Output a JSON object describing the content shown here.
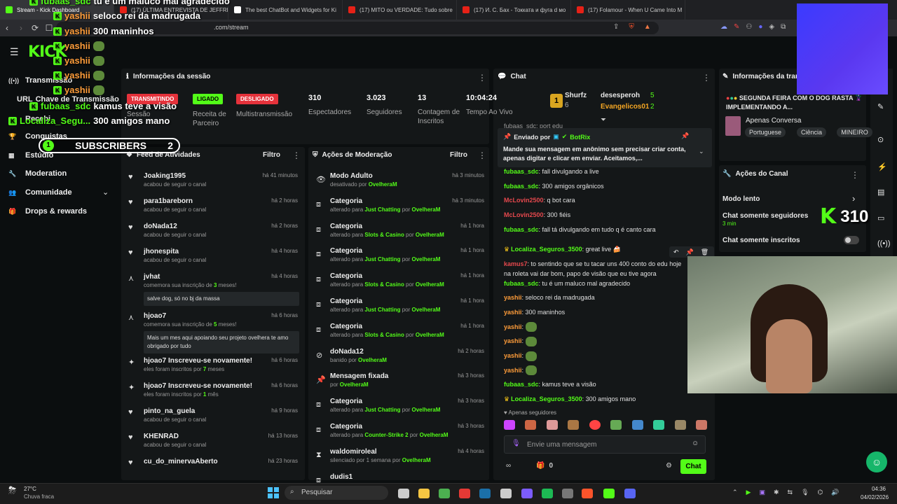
{
  "browser": {
    "tabs": [
      {
        "label": "Stream - Kick Dashboard",
        "color": "#53fc18",
        "active": true
      },
      {
        "label": "(17) ÚLTIMA ENTREVISTA DE JEFFREY",
        "color": "#e62117"
      },
      {
        "label": "The best ChatBot and Widgets for Ki",
        "color": "#ffffff"
      },
      {
        "label": "(17) MITO ou VERDADE: Tudo sobre",
        "color": "#e62117"
      },
      {
        "label": "(17) И. С. Бах - Токката и фуга d мо",
        "color": "#e62117"
      },
      {
        "label": "(17) Folamour - When U Came Into M",
        "color": "#e62117"
      }
    ],
    "url": "dashboard.kick.com/stream",
    "url_visible": ".com/stream"
  },
  "sidebar": {
    "items": [
      {
        "label": "Transmissão",
        "icon": "broadcast-icon"
      },
      {
        "label": "Chave de Transmissão",
        "icon": "key-icon"
      },
      {
        "label": "Conquistas",
        "icon": "trophy-icon"
      },
      {
        "label": "Estúdio",
        "icon": "studio-icon"
      },
      {
        "label": "Moderation",
        "icon": "wrench-icon"
      },
      {
        "label": "Comunidade",
        "icon": "users-icon"
      },
      {
        "label": "Drops & rewards",
        "icon": "gift-icon"
      }
    ],
    "extra": [
      "URL",
      "Recebi"
    ]
  },
  "session": {
    "title": "Informações da sessão",
    "badges": [
      {
        "text": "TRANSMITINDO",
        "color": "#e5323b",
        "label": "Sessão"
      },
      {
        "text": "LIGADO",
        "color": "#53fc18",
        "label": "Receita de Parceiro"
      },
      {
        "text": "DESLIGADO",
        "color": "#e5323b",
        "label": "Multistransmissão"
      }
    ],
    "stats": [
      {
        "value": "310",
        "label": "Espectadores"
      },
      {
        "value": "3.023",
        "label": "Seguidores"
      },
      {
        "value": "13",
        "label": "Contagem de Inscritos"
      },
      {
        "value": "10:04:24",
        "label": "Tempo Ao Vivo"
      }
    ]
  },
  "feed": {
    "title": "Feed de Atividades",
    "filter": "Filtro",
    "items": [
      {
        "name": "Joaking1995",
        "sub": "acabou de seguir o canal",
        "time": "há 41 minutos",
        "icon": "heart-icon"
      },
      {
        "name": "para1bareborn",
        "sub": "acabou de seguir o canal",
        "time": "há 2 horas",
        "icon": "heart-icon"
      },
      {
        "name": "doNada12",
        "sub": "acabou de seguir o canal",
        "time": "há 2 horas",
        "icon": "heart-icon"
      },
      {
        "name": "jhonespita",
        "sub": "acabou de seguir o canal",
        "time": "há 4 horas",
        "icon": "heart-icon"
      },
      {
        "name": "jvhat",
        "sub_pre": "comemora sua inscrição de ",
        "sub_num": "3",
        "sub_post": " meses!",
        "msg": "salve dog, só no bj da massa",
        "time": "há 4 horas",
        "icon": "sparkle-icon"
      },
      {
        "name": "hjoao7",
        "sub_pre": "comemora sua inscrição de ",
        "sub_num": "5",
        "sub_post": " meses!",
        "msg": "Mais um mes aqui apoiando seu projeto ovelhera te amo obrigado por tudo",
        "time": "há 6 horas",
        "icon": "sparkle-icon"
      },
      {
        "name": "hjoao7 Inscreveu-se novamente!",
        "sub_pre": "eles foram inscritos por ",
        "sub_num": "7",
        "sub_post": " meses",
        "time": "há 6 horas",
        "icon": "star-icon"
      },
      {
        "name": "hjoao7 Inscreveu-se novamente!",
        "sub_pre": "eles foram inscritos por ",
        "sub_num": "1",
        "sub_post": " mês",
        "time": "há 6 horas",
        "icon": "star-icon"
      },
      {
        "name": "pinto_na_guela",
        "sub": "acabou de seguir o canal",
        "time": "há 9 horas",
        "icon": "heart-icon"
      },
      {
        "name": "KHENRAD",
        "sub": "acabou de seguir o canal",
        "time": "há 13 horas",
        "icon": "heart-icon"
      },
      {
        "name": "cu_do_minervaAberto",
        "sub": "",
        "time": "há 23 horas",
        "icon": "heart-icon"
      }
    ]
  },
  "moderation": {
    "title": "Ações de Moderação",
    "filter": "Filtro",
    "items": [
      {
        "name": "Modo Adulto",
        "pre": "desativado por ",
        "hl": "",
        "mid": "",
        "by": "OvelheraM",
        "time": "há 3 minutos",
        "icon": "eye-icon"
      },
      {
        "name": "Categoria",
        "pre": "alterado para ",
        "hl": "Just Chatting",
        "mid": " por ",
        "by": "OvelheraM",
        "time": "há 3 minutos",
        "icon": "category-icon"
      },
      {
        "name": "Categoria",
        "pre": "alterado para ",
        "hl": "Slots & Casino",
        "mid": " por ",
        "by": "OvelheraM",
        "time": "há 1 hora",
        "icon": "category-icon"
      },
      {
        "name": "Categoria",
        "pre": "alterado para ",
        "hl": "Just Chatting",
        "mid": " por ",
        "by": "OvelheraM",
        "time": "há 1 hora",
        "icon": "category-icon"
      },
      {
        "name": "Categoria",
        "pre": "alterado para ",
        "hl": "Slots & Casino",
        "mid": " por ",
        "by": "OvelheraM",
        "time": "há 1 hora",
        "icon": "category-icon"
      },
      {
        "name": "Categoria",
        "pre": "alterado para ",
        "hl": "Just Chatting",
        "mid": " por ",
        "by": "OvelheraM",
        "time": "há 1 hora",
        "icon": "category-icon"
      },
      {
        "name": "Categoria",
        "pre": "alterado para ",
        "hl": "Slots & Casino",
        "mid": " por ",
        "by": "OvelheraM",
        "time": "há 1 hora",
        "icon": "category-icon"
      },
      {
        "name": "doNada12",
        "pre": "banido por ",
        "hl": "",
        "mid": "",
        "by": "OvelheraM",
        "time": "há 2 horas",
        "icon": "ban-icon"
      },
      {
        "name": "Mensagem fixada",
        "pre": "por ",
        "hl": "",
        "mid": "",
        "by": "OvelheraM",
        "time": "há 3 horas",
        "icon": "pin-icon"
      },
      {
        "name": "Categoria",
        "pre": "alterado para ",
        "hl": "Just Chatting",
        "mid": " por ",
        "by": "OvelheraM",
        "time": "há 3 horas",
        "icon": "category-icon"
      },
      {
        "name": "Categoria",
        "pre": "alterado para ",
        "hl": "Counter-Strike 2",
        "mid": " por ",
        "by": "OvelheraM",
        "time": "há 3 horas",
        "icon": "category-icon"
      },
      {
        "name": "waldomiroleal",
        "pre": "silenciado por 1 semana por ",
        "hl": "",
        "mid": "",
        "by": "OvelheraM",
        "time": "há 4 horas",
        "icon": "hourglass-icon"
      },
      {
        "name": "dudis1",
        "pre": "",
        "hl": "",
        "mid": "",
        "by": "",
        "time": "",
        "icon": "category-icon"
      }
    ]
  },
  "chat": {
    "title": "Chat",
    "leaderboard": [
      {
        "name": "Shurfz",
        "count": "6"
      },
      {
        "name": "desesperoh",
        "count": "5"
      },
      {
        "name": "Evangelicos01",
        "count": "2"
      }
    ],
    "pinned": {
      "header": "Enviado por",
      "bot": "BotRix",
      "text": "Mande sua mensagem em anônimo sem precisar criar conta, apenas digitar e clicar em enviar. Aceitamos,..."
    },
    "partial_top": "fubaas_sdc: port edu",
    "messages": [
      {
        "user": "fubaas_sdc",
        "color": "green",
        "text": "fall divulgando a live"
      },
      {
        "user": "fubaas_sdc",
        "color": "green",
        "text": "300 amigos orgânicos"
      },
      {
        "user": "McLovin2500",
        "color": "red",
        "text": "q bot cara"
      },
      {
        "user": "McLovin2500",
        "color": "red",
        "text": "300 fiéis"
      },
      {
        "user": "fubaas_sdc",
        "color": "green",
        "text": "fall tá divulgando em tudo q é canto cara"
      },
      {
        "user": "Localiza_Seguros_3500",
        "color": "green",
        "text": "great live 🍰",
        "badge": true
      },
      {
        "user": "kamus7",
        "color": "red",
        "text": "to sentindo que se tu tacar uns 400 conto do edu hoje na roleta vai dar bom, papo de visão que eu tive agora"
      },
      {
        "user": "fubaas_sdc",
        "color": "green",
        "text": "tu é um maluco mal agradecido"
      },
      {
        "user": "yashii",
        "color": "orange",
        "text": "seloco rei da madrugada"
      },
      {
        "user": "yashii",
        "color": "orange",
        "text": "300 maninhos"
      },
      {
        "user": "yashii",
        "color": "orange",
        "text": "",
        "emote": true
      },
      {
        "user": "yashii",
        "color": "orange",
        "text": "",
        "emote": true
      },
      {
        "user": "yashii",
        "color": "orange",
        "text": "",
        "emote": true
      },
      {
        "user": "yashii",
        "color": "orange",
        "text": "",
        "emote": true
      },
      {
        "user": "fubaas_sdc",
        "color": "green",
        "text": "kamus teve a visão"
      },
      {
        "user": "Localiza_Seguros_3500",
        "color": "green",
        "text": "300 amigos mano",
        "badge": true
      }
    ],
    "followers_only": "Apenas seguidores",
    "input_placeholder": "Envie uma mensagem",
    "points": "0",
    "send_label": "Chat"
  },
  "stream_info": {
    "title": "Informações da transmissão",
    "stream_title": "SEGUNDA FEIRA COM O DOG RASTA 🦹 IMPLEMENTANDO A...",
    "category": "Apenas Conversa",
    "tags": [
      "Portuguese",
      "Ciência",
      "MINEIRO"
    ]
  },
  "channel_actions": {
    "title": "Ações do Canal",
    "items": [
      {
        "label": "Modo lento"
      },
      {
        "label": "Chat somente seguidores",
        "sub": "3 min"
      },
      {
        "label": "Chat somente inscritos"
      }
    ]
  },
  "overlay": {
    "chat": [
      {
        "user": "fubaas_sdc",
        "text": "tu é um maluco mal agradecido"
      },
      {
        "user": "yashii",
        "text": "seloco rei da madrugada"
      },
      {
        "user": "yashii",
        "text": "300 maninhos"
      },
      {
        "user": "yashii",
        "text": ""
      },
      {
        "user": "yashii",
        "text": ""
      },
      {
        "user": "yashii",
        "text": ""
      },
      {
        "user": "yashii",
        "text": ""
      },
      {
        "user": "fubaas_sdc",
        "text": "kamus teve a visão"
      },
      {
        "user": "Localiza_Segu...",
        "text": "300 amigos mano"
      }
    ],
    "sub_goal": {
      "left": "1",
      "label": "SUBSCRIBERS",
      "right": "2"
    },
    "viewer_count": "310"
  },
  "taskbar": {
    "weather_temp": "27°C",
    "weather_desc": "Chuva fraca",
    "search": "Pesquisar",
    "time": "04:36",
    "date": "04/02/2026"
  }
}
